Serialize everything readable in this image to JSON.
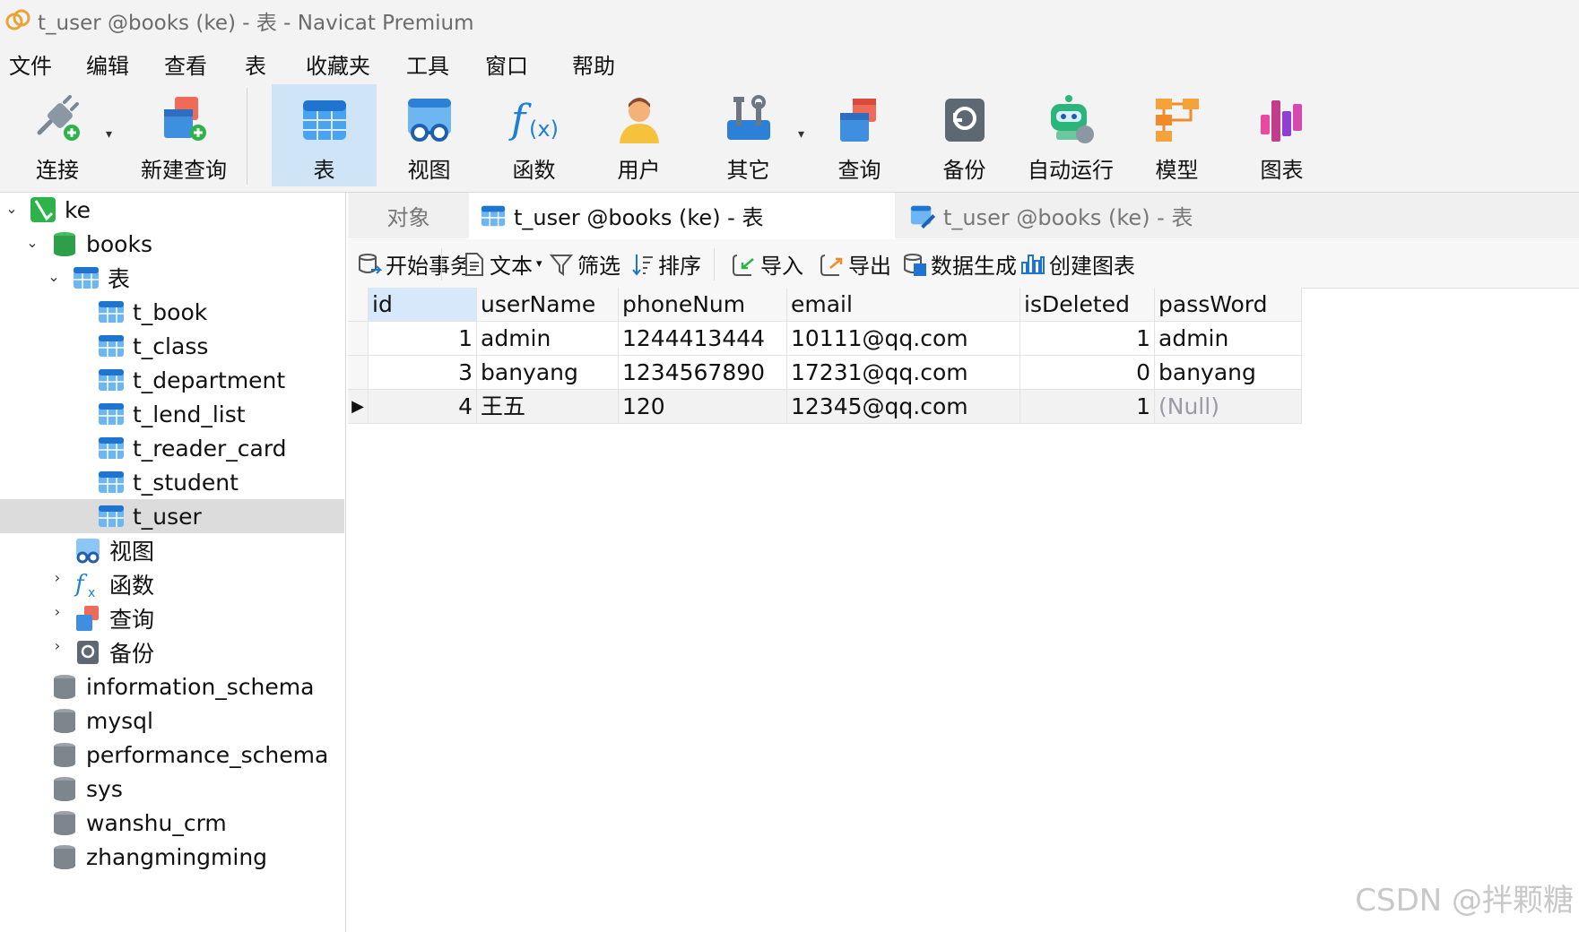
{
  "window": {
    "title": "t_user @books (ke) - 表 - Navicat Premium"
  },
  "menu": [
    "文件",
    "编辑",
    "查看",
    "表",
    "收藏夹",
    "工具",
    "窗口",
    "帮助"
  ],
  "toolbar": {
    "connect": "连接",
    "new_query": "新建查询",
    "table": "表",
    "view": "视图",
    "function": "函数",
    "user": "用户",
    "other": "其它",
    "query": "查询",
    "backup": "备份",
    "automation": "自动运行",
    "model": "模型",
    "chart": "图表"
  },
  "tree": {
    "connection": "ke",
    "database": "books",
    "tables_group": "表",
    "tables": [
      "t_book",
      "t_class",
      "t_department",
      "t_lend_list",
      "t_reader_card",
      "t_student",
      "t_user"
    ],
    "selected_table": "t_user",
    "views_group": "视图",
    "functions_group": "函数",
    "queries_group": "查询",
    "backups_group": "备份",
    "other_databases": [
      "information_schema",
      "mysql",
      "performance_schema",
      "sys",
      "wanshu_crm",
      "zhangmingming"
    ]
  },
  "tabs": {
    "objects": "对象",
    "active": "t_user @books (ke) - 表",
    "design": "t_user @books (ke) - 表"
  },
  "subtoolbar": {
    "begin_transaction": "开始事务",
    "text": "文本",
    "filter": "筛选",
    "sort": "排序",
    "import": "导入",
    "export": "导出",
    "data_generation": "数据生成",
    "create_chart": "创建图表"
  },
  "table": {
    "columns": [
      "id",
      "userName",
      "phoneNum",
      "email",
      "isDeleted",
      "passWord"
    ],
    "rows": [
      [
        "1",
        "admin",
        "1244413444",
        "10111@qq.com",
        "1",
        "admin"
      ],
      [
        "3",
        "banyang",
        "1234567890",
        "17231@qq.com",
        "0",
        "banyang"
      ],
      [
        "4",
        "王五",
        "120",
        "12345@qq.com",
        "1",
        "(Null)"
      ]
    ]
  },
  "watermark": "CSDN @拌颗糖"
}
